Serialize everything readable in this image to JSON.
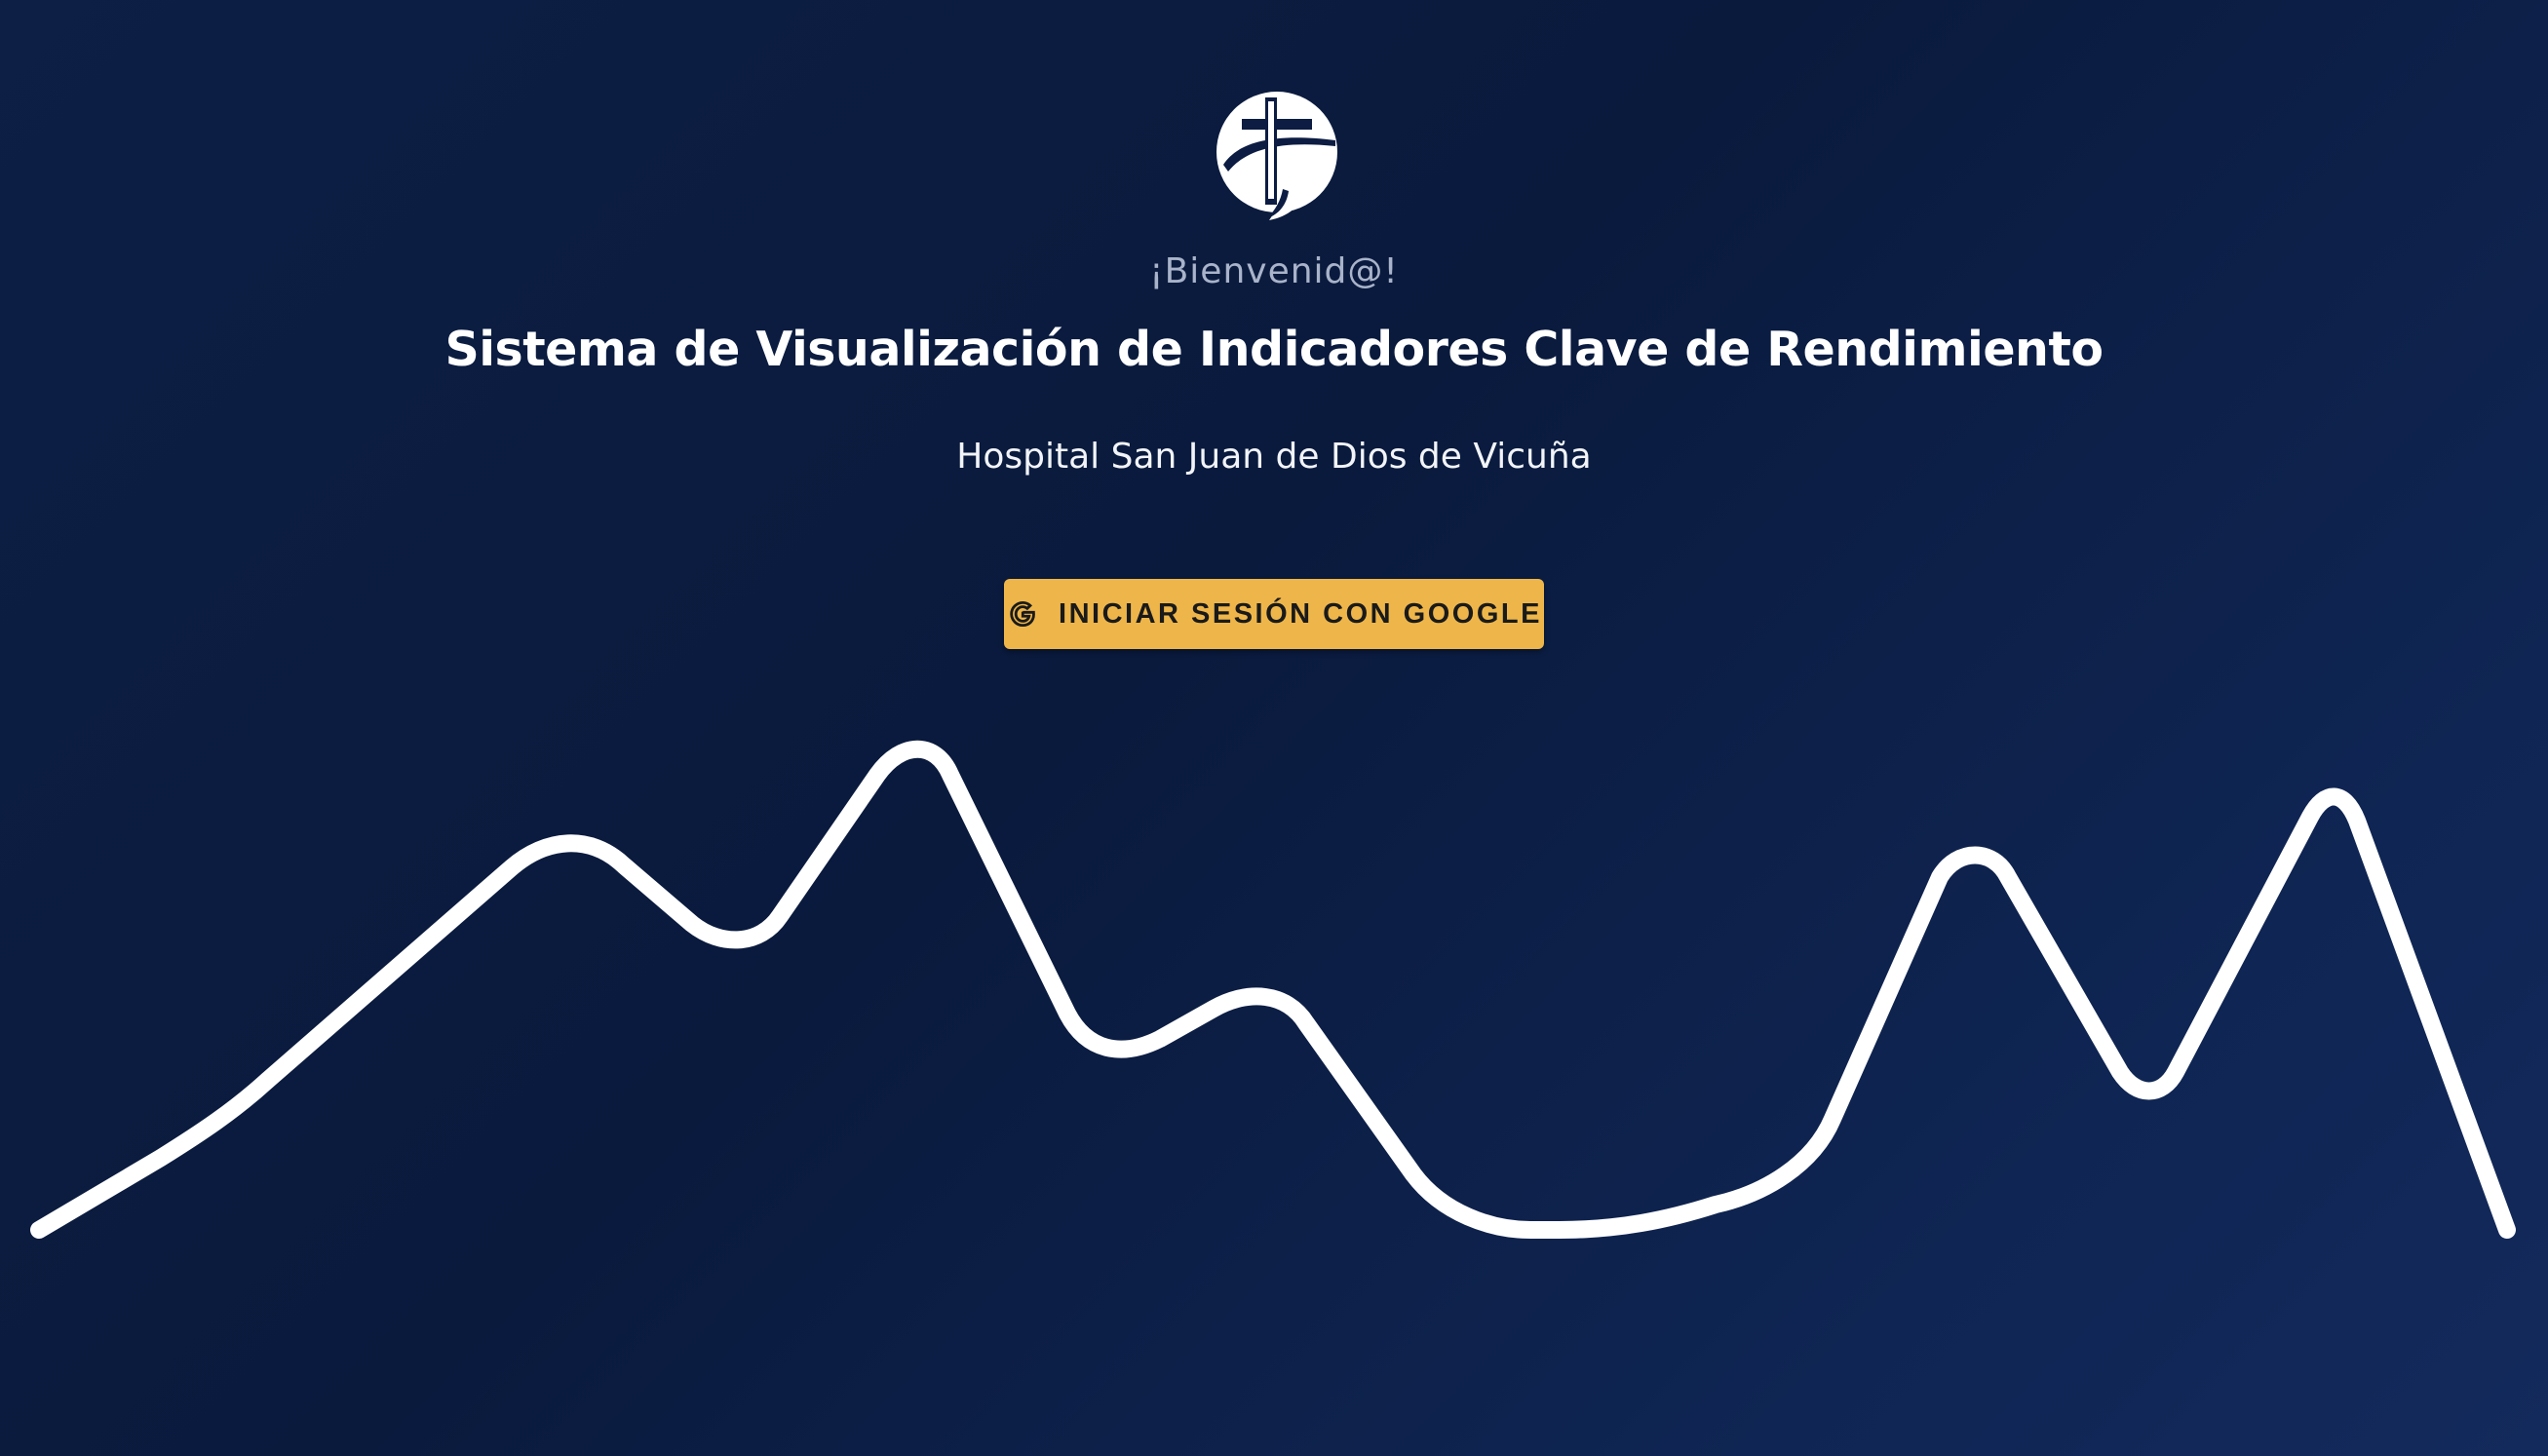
{
  "header": {
    "logo_icon": "hospital-cross-globe-icon",
    "welcome": "¡Bienvenid@!",
    "title": "Sistema de Visualización de Indicadores Clave de Rendimiento",
    "subtitle": "Hospital San Juan de Dios de Vicuña"
  },
  "login": {
    "button_label": "INICIAR SESIÓN CON GOOGLE",
    "button_icon": "google-g-icon",
    "button_color": "#eeb64a"
  },
  "decoration": {
    "wave_icon": "pulse-line-decoration",
    "wave_color": "#ffffff"
  },
  "theme": {
    "background": "#0a1a3d"
  }
}
